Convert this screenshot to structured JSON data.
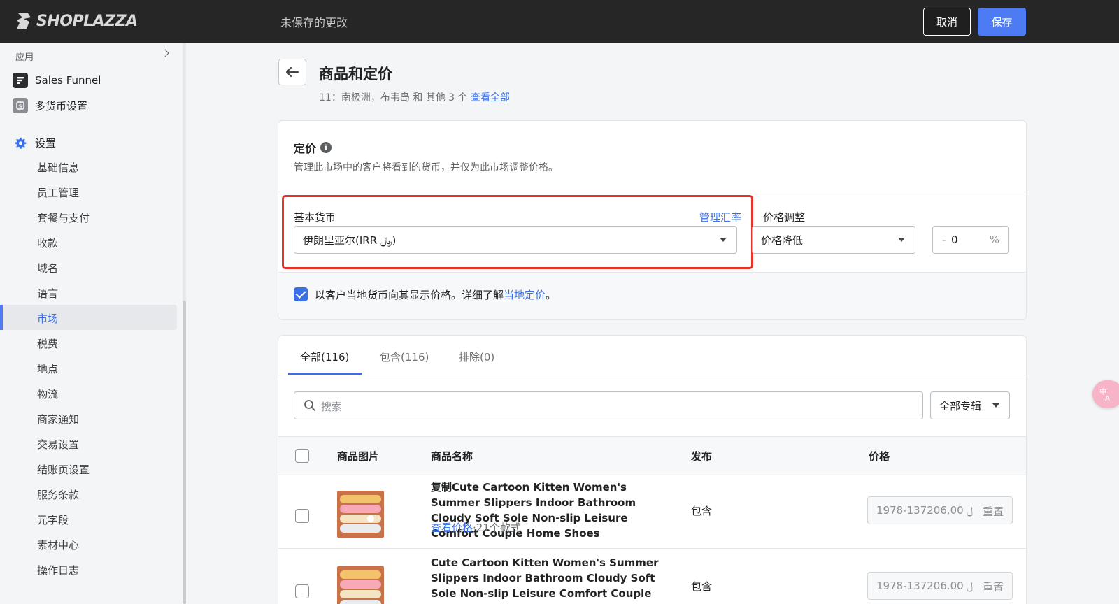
{
  "topbar": {
    "brand": "SHOPLAZZA",
    "status": "未保存的更改",
    "cancel_label": "取消",
    "save_label": "保存"
  },
  "sidebar": {
    "apps_label": "应用",
    "apps": [
      {
        "label": "Sales Funnel",
        "icon": "sales-funnel-icon"
      },
      {
        "label": "多货币设置",
        "icon": "multi-currency-icon"
      }
    ],
    "settings_label": "设置",
    "items": [
      {
        "label": "基础信息"
      },
      {
        "label": "员工管理"
      },
      {
        "label": "套餐与支付"
      },
      {
        "label": "收款"
      },
      {
        "label": "域名"
      },
      {
        "label": "语言"
      },
      {
        "label": "市场",
        "active": true
      },
      {
        "label": "税费"
      },
      {
        "label": "地点"
      },
      {
        "label": "物流"
      },
      {
        "label": "商家通知"
      },
      {
        "label": "交易设置"
      },
      {
        "label": "结账页设置"
      },
      {
        "label": "服务条款"
      },
      {
        "label": "元字段"
      },
      {
        "label": "素材中心"
      },
      {
        "label": "操作日志"
      }
    ]
  },
  "header": {
    "title": "商品和定价",
    "subtitle": "11：南极洲，布韦岛 和 其他 3 个",
    "view_all": "查看全部"
  },
  "pricing": {
    "title": "定价",
    "description": "管理此市场中的客户将看到的货币，并仅为此市场调整价格。",
    "base_currency_label": "基本货币",
    "manage_rates_link": "管理汇率",
    "base_currency_value": "伊朗里亚尔(IRR ﷼)",
    "adjust_label": "价格调整",
    "adjust_value": "价格降低",
    "adjust_minus": "-",
    "adjust_amount": "0",
    "adjust_unit": "%",
    "local_pricing_checked": true,
    "local_pricing_text": "以客户当地货币向其显示价格。详细了解",
    "local_pricing_link": "当地定价",
    "local_pricing_end": "。"
  },
  "products": {
    "tabs": [
      {
        "label": "全部(116)",
        "active": true
      },
      {
        "label": "包含(116)"
      },
      {
        "label": "排除(0)"
      }
    ],
    "search_placeholder": "搜索",
    "collection_filter": "全部专辑",
    "columns": [
      "商品图片",
      "商品名称",
      "发布",
      "价格"
    ],
    "rows": [
      {
        "name": "复制Cute Cartoon Kitten Women's Summer Slippers Indoor Bathroom Cloudy Soft Sole Non-slip Leisure Comfort Couple Home Shoes",
        "view_price": "查看价格",
        "variants": "·21个款式",
        "publish": "包含",
        "price": "﷼ 137206.00-1978",
        "reset": "重置"
      },
      {
        "name": "Cute Cartoon Kitten Women's Summer Slippers Indoor Bathroom Cloudy Soft Sole Non-slip Leisure Comfort Couple Home Shoes",
        "publish": "包含",
        "price": "﷼ 137206.00-1978",
        "reset": "重置"
      }
    ]
  },
  "colors": {
    "accent": "#4c7bf3",
    "link": "#3b6fe5",
    "topbar_bg": "#262626",
    "highlight": "#e8322b"
  }
}
